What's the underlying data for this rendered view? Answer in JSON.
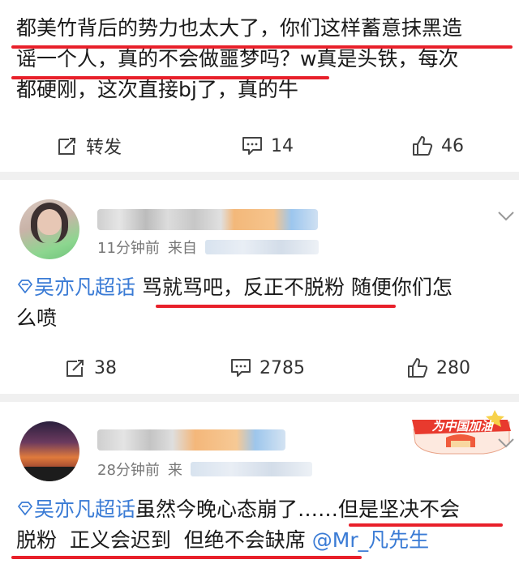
{
  "post1": {
    "text_lines": [
      "都美竹背后的势力也太大了，你们这样蓄意抹黑造",
      "谣一个人，真的不会做噩梦吗？w真是头铁，每次",
      "都硬刚，这次直接bj了，真的牛"
    ],
    "repost_label": "转发",
    "comment_count": "14",
    "like_count": "46"
  },
  "post2": {
    "time": "11分钟前",
    "source_prefix": "来自",
    "topic": "吴亦凡超话",
    "text_line1_rest": " 骂就骂吧，反正不脱粉 随便你们怎",
    "text_line2": "么喷",
    "repost_count": "38",
    "comment_count": "2785",
    "like_count": "280"
  },
  "post3": {
    "time": "28分钟前",
    "source_prefix": "来",
    "topic": "吴亦凡超话",
    "text_line1_rest": "虽然今晚心态崩了……但是坚决不会",
    "text_line2": "脱粉  正义会迟到  但绝不会缺席 ",
    "mention": "@Mr_凡先生",
    "badge_text": "为中国加油"
  },
  "icons": {
    "repost": "repost-icon",
    "comment": "comment-icon",
    "like": "thumbs-up-icon",
    "topic": "diamond-topic-icon",
    "more": "chevron-down-icon"
  },
  "colors": {
    "link": "#3a7bd5",
    "underline": "#e8202a",
    "separator": "#f0f0f0"
  }
}
